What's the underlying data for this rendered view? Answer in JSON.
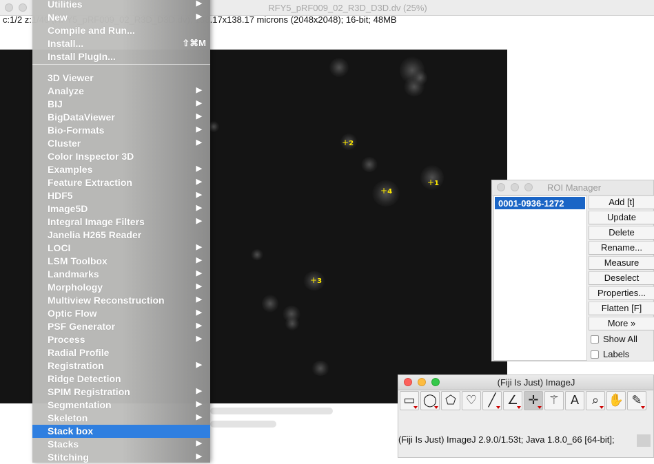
{
  "image_window": {
    "title": "RFY5_pRF009_02_R3D_D3D.dv (25%)",
    "info": "c:1/2 z:1/40 (RFY5_pRF009_02_R3D_D3D.dv); 138.17x138.17 microns (2048x2048); 16-bit; 48MB",
    "markers": [
      "1",
      "2",
      "3",
      "4"
    ]
  },
  "plugins_menu": {
    "items": [
      {
        "label": "Utilities",
        "arrow": "▶"
      },
      {
        "label": "New",
        "arrow": "▶"
      },
      {
        "label": "Compile and Run...",
        "arrow": ""
      },
      {
        "label": "Install...",
        "shortcut": "⇧⌘M"
      },
      {
        "label": "Install PlugIn...",
        "arrow": ""
      },
      {
        "label": "3D Viewer",
        "arrow": ""
      },
      {
        "label": "Analyze",
        "arrow": "▶"
      },
      {
        "label": "BIJ",
        "arrow": "▶"
      },
      {
        "label": "BigDataViewer",
        "arrow": "▶"
      },
      {
        "label": "Bio-Formats",
        "arrow": "▶"
      },
      {
        "label": "Cluster",
        "arrow": "▶"
      },
      {
        "label": "Color Inspector 3D",
        "arrow": ""
      },
      {
        "label": "Examples",
        "arrow": "▶"
      },
      {
        "label": "Feature Extraction",
        "arrow": "▶"
      },
      {
        "label": "HDF5",
        "arrow": "▶"
      },
      {
        "label": "Image5D",
        "arrow": "▶"
      },
      {
        "label": "Integral Image Filters",
        "arrow": "▶"
      },
      {
        "label": "Janelia H265 Reader",
        "arrow": ""
      },
      {
        "label": "LOCI",
        "arrow": "▶"
      },
      {
        "label": "LSM Toolbox",
        "arrow": "▶"
      },
      {
        "label": "Landmarks",
        "arrow": "▶"
      },
      {
        "label": "Morphology",
        "arrow": "▶"
      },
      {
        "label": "Multiview Reconstruction",
        "arrow": "▶"
      },
      {
        "label": "Optic Flow",
        "arrow": "▶"
      },
      {
        "label": "PSF Generator",
        "arrow": "▶"
      },
      {
        "label": "Process",
        "arrow": "▶"
      },
      {
        "label": "Radial Profile",
        "arrow": ""
      },
      {
        "label": "Registration",
        "arrow": "▶"
      },
      {
        "label": "Ridge Detection",
        "arrow": ""
      },
      {
        "label": "SPIM Registration",
        "arrow": "▶"
      },
      {
        "label": "Segmentation",
        "arrow": "▶"
      },
      {
        "label": "Skeleton",
        "arrow": "▶"
      },
      {
        "label": "Stack box",
        "arrow": "",
        "selected": true
      },
      {
        "label": "Stacks",
        "arrow": "▶"
      },
      {
        "label": "Stitching",
        "arrow": "▶"
      }
    ]
  },
  "roi_manager": {
    "title": "ROI Manager",
    "list_items": [
      "0001-0936-1272"
    ],
    "buttons": [
      "Add [t]",
      "Update",
      "Delete",
      "Rename...",
      "Measure",
      "Deselect",
      "Properties...",
      "Flatten [F]",
      "More »"
    ],
    "checkboxes": [
      {
        "label": "Show All",
        "checked": false
      },
      {
        "label": "Labels",
        "checked": false
      }
    ]
  },
  "imagej": {
    "title": "(Fiji Is Just) ImageJ",
    "status": "(Fiji Is Just) ImageJ 2.9.0/1.53t; Java 1.8.0_66 [64-bit];",
    "tools": [
      {
        "name": "rectangle-tool-icon",
        "glyph": "▭"
      },
      {
        "name": "oval-tool-icon",
        "glyph": "◯"
      },
      {
        "name": "polygon-tool-icon",
        "glyph": "⬠"
      },
      {
        "name": "freehand-tool-icon",
        "glyph": "♡"
      },
      {
        "name": "line-tool-icon",
        "glyph": "╱"
      },
      {
        "name": "angle-tool-icon",
        "glyph": "∠"
      },
      {
        "name": "point-tool-icon",
        "glyph": "✛"
      },
      {
        "name": "wand-tool-icon",
        "glyph": "⚚"
      },
      {
        "name": "text-tool-icon",
        "glyph": "A"
      },
      {
        "name": "zoom-tool-icon",
        "glyph": "⌕"
      },
      {
        "name": "hand-tool-icon",
        "glyph": "✋"
      },
      {
        "name": "color-picker-icon",
        "glyph": "✎"
      }
    ],
    "active_tool": "point-tool-icon",
    "traffic_light_colors": {
      "close": "#fc605b",
      "minimize": "#fdbc40",
      "zoom": "#34c84a"
    }
  }
}
